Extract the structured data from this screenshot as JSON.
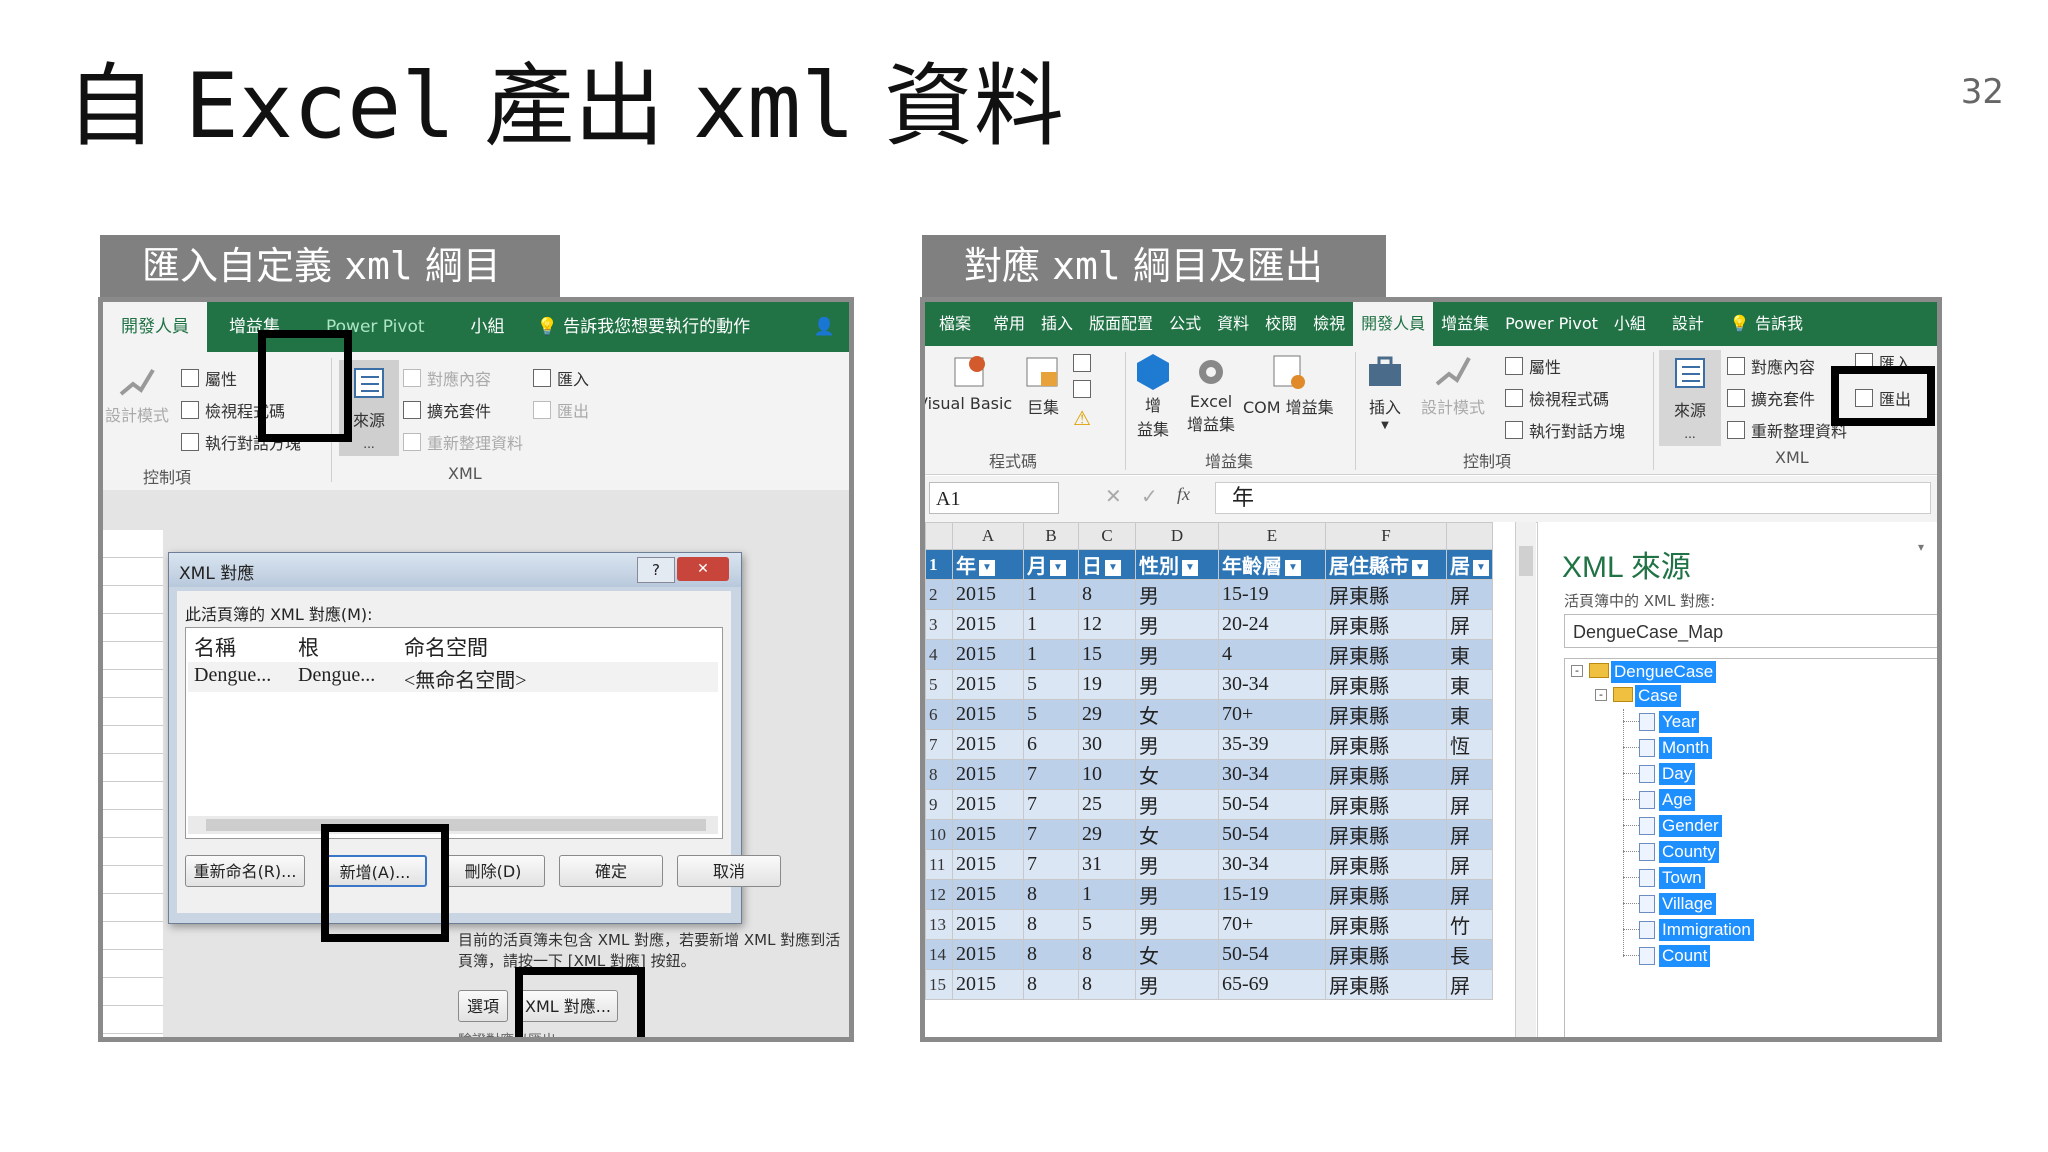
{
  "slide": {
    "title_parts": [
      "自 ",
      "Excel",
      " 產出 ",
      "xml",
      " 資料"
    ],
    "page_number": "32"
  },
  "left": {
    "label_parts": [
      "匯入自定義 ",
      "xml",
      " 綱目"
    ],
    "tabs": [
      "開發人員",
      "增益集",
      "Power Pivot",
      "小組",
      "告訴我您想要執行的動作"
    ],
    "ribbon": {
      "design_mode": "設計模式",
      "properties": "屬性",
      "view_code": "檢視程式碼",
      "run_dialog": "執行對話方塊",
      "source": "來源",
      "map_props": "對應內容",
      "expansion": "擴充套件",
      "refresh": "重新整理資料",
      "import": "匯入",
      "export": "匯出",
      "group_controls": "控制項",
      "group_xml": "XML"
    },
    "dialog": {
      "title": "XML 對應",
      "help": "?",
      "close": "✕",
      "list_label": "此活頁簿的 XML 對應(M):",
      "columns": [
        "名稱",
        "根",
        "命名空間"
      ],
      "row": [
        "Dengue...",
        "Dengue...",
        "<無命名空間>"
      ],
      "buttons": [
        "重新命名(R)...",
        "新增(A)...",
        "刪除(D)",
        "確定",
        "取消"
      ]
    },
    "pane": {
      "message": "目前的活頁簿未包含 XML 對應，若要新增 XML 對應到活頁簿，請按一下 [XML 對應] 按鈕。",
      "options": "選項",
      "xml_maps_button": "XML 對應...",
      "verify": "驗證對應以匯出"
    }
  },
  "right": {
    "label_parts": [
      "對應 ",
      "xml",
      " 綱目及匯出"
    ],
    "tabs": [
      "檔案",
      "常用",
      "插入",
      "版面配置",
      "公式",
      "資料",
      "校閱",
      "檢視",
      "開發人員",
      "增益集",
      "Power Pivot",
      "小組",
      "設計",
      "告訴我"
    ],
    "ribbon": {
      "vb": "Visual Basic",
      "macros": "巨集",
      "addins": "增",
      "addins2": "益集",
      "excel_addins": "Excel",
      "excel_addins2": "增益集",
      "com_addins": "COM 增益集",
      "insert": "插入",
      "design_mode": "設計模式",
      "properties": "屬性",
      "view_code": "檢視程式碼",
      "run_dialog": "執行對話方塊",
      "source": "來源",
      "map_props": "對應內容",
      "expansion": "擴充套件",
      "refresh": "重新整理資料",
      "import": "匯入",
      "export": "匯出",
      "group_code": "程式碼",
      "group_addins": "增益集",
      "group_controls": "控制項",
      "group_xml": "XML"
    },
    "formula_bar": {
      "name_box": "A1",
      "fx": "fx",
      "value": "年"
    },
    "sheet": {
      "col_letters": [
        "A",
        "B",
        "C",
        "D",
        "E",
        "F"
      ],
      "header": [
        "年",
        "月",
        "日",
        "性別",
        "年齡層",
        "居住縣市",
        "居"
      ],
      "rows": [
        [
          "2015",
          "1",
          "8",
          "男",
          "15-19",
          "屏東縣",
          "屏"
        ],
        [
          "2015",
          "1",
          "12",
          "男",
          "20-24",
          "屏東縣",
          "屏"
        ],
        [
          "2015",
          "1",
          "15",
          "男",
          "4",
          "屏東縣",
          "東"
        ],
        [
          "2015",
          "5",
          "19",
          "男",
          "30-34",
          "屏東縣",
          "東"
        ],
        [
          "2015",
          "5",
          "29",
          "女",
          "70+",
          "屏東縣",
          "東"
        ],
        [
          "2015",
          "6",
          "30",
          "男",
          "35-39",
          "屏東縣",
          "恆"
        ],
        [
          "2015",
          "7",
          "10",
          "女",
          "30-34",
          "屏東縣",
          "屏"
        ],
        [
          "2015",
          "7",
          "25",
          "男",
          "50-54",
          "屏東縣",
          "屏"
        ],
        [
          "2015",
          "7",
          "29",
          "女",
          "50-54",
          "屏東縣",
          "屏"
        ],
        [
          "2015",
          "7",
          "31",
          "男",
          "30-34",
          "屏東縣",
          "屏"
        ],
        [
          "2015",
          "8",
          "1",
          "男",
          "15-19",
          "屏東縣",
          "屏"
        ],
        [
          "2015",
          "8",
          "5",
          "男",
          "70+",
          "屏東縣",
          "竹"
        ],
        [
          "2015",
          "8",
          "8",
          "女",
          "50-54",
          "屏東縣",
          "長"
        ],
        [
          "2015",
          "8",
          "8",
          "男",
          "65-69",
          "屏東縣",
          "屏"
        ]
      ],
      "row_numbers": [
        "1",
        "2",
        "3",
        "4",
        "5",
        "6",
        "7",
        "8",
        "9",
        "10",
        "11",
        "12",
        "13",
        "14",
        "15"
      ]
    },
    "xml_source": {
      "title": "XML 來源",
      "maps_label": "活頁簿中的 XML 對應:",
      "selected_map": "DengueCase_Map",
      "tree": {
        "root": "DengueCase",
        "child": "Case",
        "leaves": [
          "Year",
          "Month",
          "Day",
          "Age",
          "Gender",
          "County",
          "Town",
          "Village",
          "Immigration",
          "Count"
        ]
      }
    }
  }
}
